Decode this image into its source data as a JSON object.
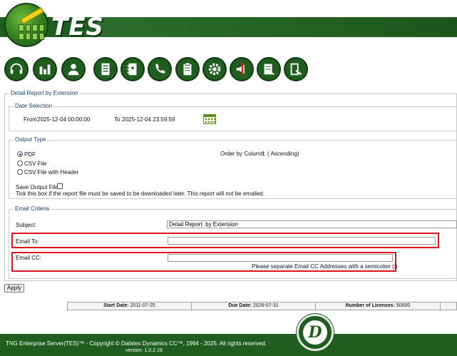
{
  "header": {
    "logo_text": "TES"
  },
  "toolbar": {
    "icons": [
      "headset-icon",
      "bar-chart-icon",
      "user-icon",
      "report-icon",
      "phonebook-icon",
      "phone-icon",
      "clipboard-icon",
      "gear-icon",
      "announce-icon",
      "export-icon",
      "logout-icon"
    ]
  },
  "report": {
    "legend": "Detail Report by Extension",
    "date_selection": {
      "legend": "Date Selection",
      "from_label": "From",
      "from_value": "2025-12-04 00:00:00",
      "to_label": "To",
      "to_value": "2025-12-04 23:59:59"
    },
    "output_type": {
      "legend": "Output Type",
      "options": [
        "PDF",
        "CSV File",
        "CSV File with Header"
      ],
      "selected": "PDF",
      "order_label": "Order by Column:",
      "order_value": "1",
      "order_direction": "( Ascending)",
      "save_label": "Save Output File:",
      "save_hint": "Tick this box if the report file must be saved to be downloaded later. This report will not be emailed."
    },
    "email": {
      "legend": "Email Criteria",
      "subject_label": "Subject:",
      "subject_value": "Detail Report  by Extension",
      "to_label": "Email To:",
      "to_value": "",
      "cc_label": "Email CC:",
      "cc_value": "",
      "cc_hint": "Please separate Email CC Addresses with a semicolon (;)"
    },
    "apply_label": "Apply"
  },
  "license": {
    "start_label": "Start Date:",
    "start_value": "2011-07-25",
    "due_label": "Due Date:",
    "due_value": "2026-07-31",
    "licenses_label": "Number of Licenses:",
    "licenses_value": "50000"
  },
  "footer": {
    "copyright": "TNG Enterprise Server(TES)™ - Copyright © Datatex Dynamics CC™, 1994 - 2025. All rights reserved.",
    "version": "version: 1.0.2.19",
    "logo_letter": "D"
  },
  "colors": {
    "brand_green": "#1f5e1f",
    "highlight_red": "#e0141e",
    "legend_blue": "#1b3f6b"
  }
}
